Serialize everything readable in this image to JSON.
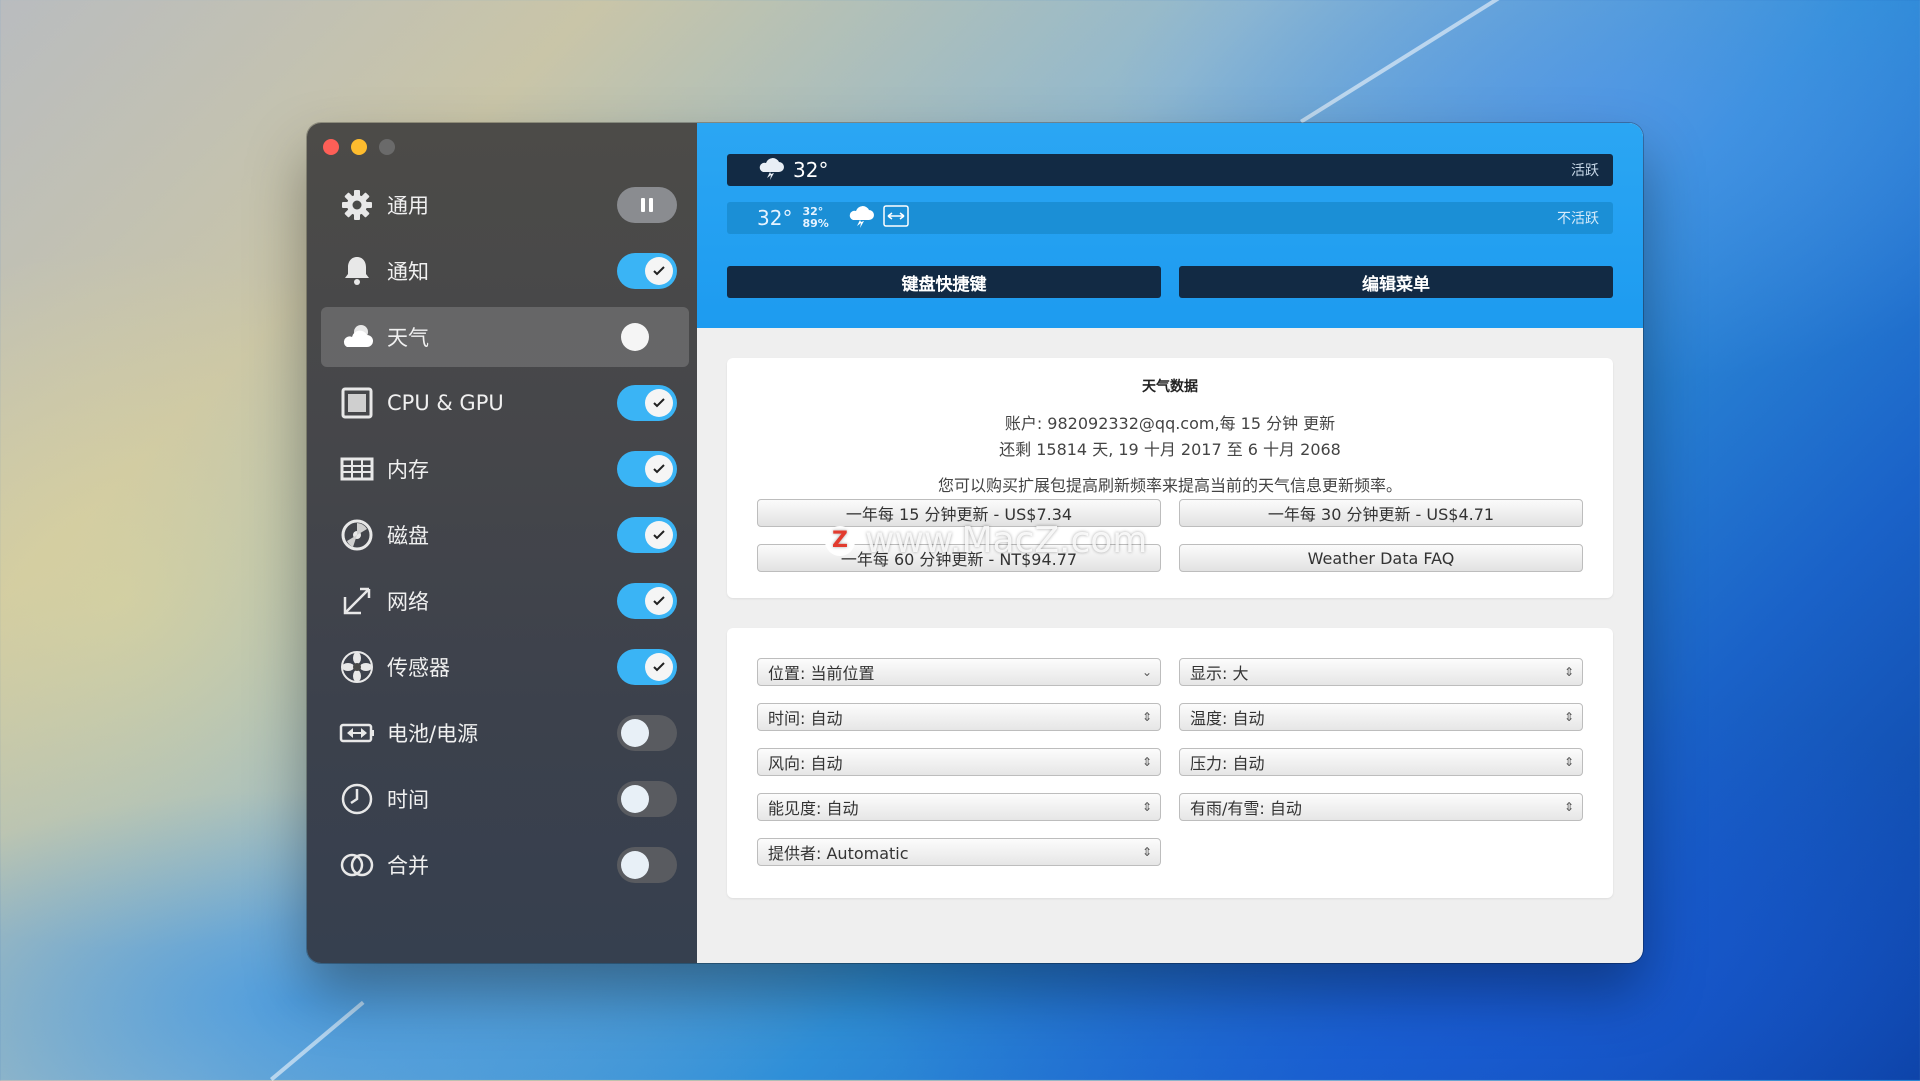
{
  "sidebar": {
    "items": [
      {
        "label": "通用",
        "icon": "gear-icon",
        "toggle": "pause"
      },
      {
        "label": "通知",
        "icon": "bell-icon",
        "toggle": "on"
      },
      {
        "label": "天气",
        "icon": "cloud-icon",
        "toggle": "off",
        "selected": true
      },
      {
        "label": "CPU & GPU",
        "icon": "chip-icon",
        "toggle": "on"
      },
      {
        "label": "内存",
        "icon": "memory-icon",
        "toggle": "on"
      },
      {
        "label": "磁盘",
        "icon": "disk-icon",
        "toggle": "on"
      },
      {
        "label": "网络",
        "icon": "network-arrows-icon",
        "toggle": "on"
      },
      {
        "label": "传感器",
        "icon": "fan-icon",
        "toggle": "on"
      },
      {
        "label": "电池/电源",
        "icon": "battery-icon",
        "toggle": "off"
      },
      {
        "label": "时间",
        "icon": "clock-icon",
        "toggle": "off"
      },
      {
        "label": "合并",
        "icon": "combine-rings-icon",
        "toggle": "off"
      }
    ]
  },
  "menubar_preview": {
    "active": {
      "temp": "32°",
      "status": "活跃"
    },
    "inactive": {
      "temp": "32°",
      "mini_temp": "32°",
      "mini_humidity": "89%",
      "status": "不活跃"
    }
  },
  "band_buttons": {
    "shortcuts": "键盘快捷键",
    "edit_menu": "编辑菜单"
  },
  "weather_data": {
    "title": "天气数据",
    "account_line": "账户: 982092332@qq.com,每 15 分钟 更新",
    "remaining_line": "还剩 15814 天, 19 十月 2017 至 6 十月 2068",
    "upsell_line": "您可以购买扩展包提高刷新频率来提高当前的天气信息更新频率。",
    "buttons": {
      "plan_15": "一年每 15 分钟更新 - US$7.34",
      "plan_30": "一年每 30 分钟更新 - US$4.71",
      "plan_60": "一年每 60 分钟更新 - NT$94.77",
      "faq": "Weather Data FAQ"
    },
    "watermark": {
      "logo": "Z",
      "text": "www.MacZ.com"
    }
  },
  "settings": {
    "location": "位置:  当前位置",
    "display": "显示:   大",
    "time": "时间: 自动",
    "temperature": "温度: 自动",
    "wind": "风向: 自动",
    "pressure": "压力: 自动",
    "visibility": "能见度: 自动",
    "precip": "有雨/有雪: 自动",
    "provider": "提供者: Automatic"
  },
  "colors": {
    "accent": "#1d9bf0",
    "dark_bar": "#122a44",
    "toggle_on": "#3ab4f5"
  }
}
